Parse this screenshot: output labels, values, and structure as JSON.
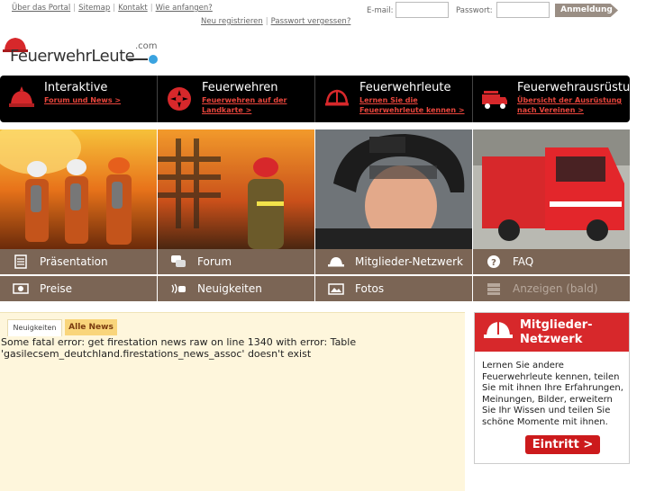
{
  "top": {
    "links": [
      "Über das Portal",
      "Sitemap",
      "Kontakt",
      "Wie anfangen?"
    ],
    "sublinks": [
      "Neu registrieren",
      "Passwort vergessen?"
    ],
    "email_label": "E-mail:",
    "password_label": "Passwort:",
    "login_label": "Anmeldung"
  },
  "logo": {
    "text": "FeuerwehrLeute",
    "com": ".com"
  },
  "nav": [
    {
      "title": "Interaktive",
      "sub": "Forum und News >",
      "icon": "firefighter-helmet-icon"
    },
    {
      "title": "Feuerwehren",
      "sub": "Feuerwehren auf der Landkarte >",
      "icon": "fire-emblem-icon"
    },
    {
      "title": "Feuerwehrleute",
      "sub": "Lernen Sie die Feuerwehrleute kennen >",
      "icon": "helmet-icon"
    },
    {
      "title": "Feuerwehrausrüstung",
      "sub": "Übersicht der Ausrüstung nach Vereinen >",
      "icon": "fire-truck-icon"
    }
  ],
  "menu": [
    {
      "label": "Präsentation",
      "icon": "presentation-icon"
    },
    {
      "label": "Forum",
      "icon": "forum-icon"
    },
    {
      "label": "Mitglieder-Netzwerk",
      "icon": "helmet-icon"
    },
    {
      "label": "FAQ",
      "icon": "question-icon"
    },
    {
      "label": "Preise",
      "icon": "money-icon"
    },
    {
      "label": "Neuigkeiten",
      "icon": "news-icon"
    },
    {
      "label": "Fotos",
      "icon": "photo-icon"
    },
    {
      "label": "Anzeigen (bald)",
      "icon": "ads-icon"
    }
  ],
  "news": {
    "tab_active": "Neuigkeiten",
    "tab_all": "Alle News",
    "error": "Some fatal error: get firestation news raw on line 1340 with error: Table 'gasilecsem_deutchland.firestations_news_assoc' doesn't exist"
  },
  "sidebar": {
    "title": "Mitglieder-Netzwerk",
    "body": "Lernen Sie andere Feuerwehrleute kennen, teilen Sie mit ihnen Ihre Erfahrungen, Meinungen, Bilder, erweitern Sie Ihr Wissen und teilen Sie schöne Momente mit ihnen.",
    "button": "Eintritt >"
  },
  "colors": {
    "accent_red": "#d7282b",
    "menu_brown": "#7b6555",
    "nav_black": "#000000",
    "news_bg": "#fef6dc"
  }
}
